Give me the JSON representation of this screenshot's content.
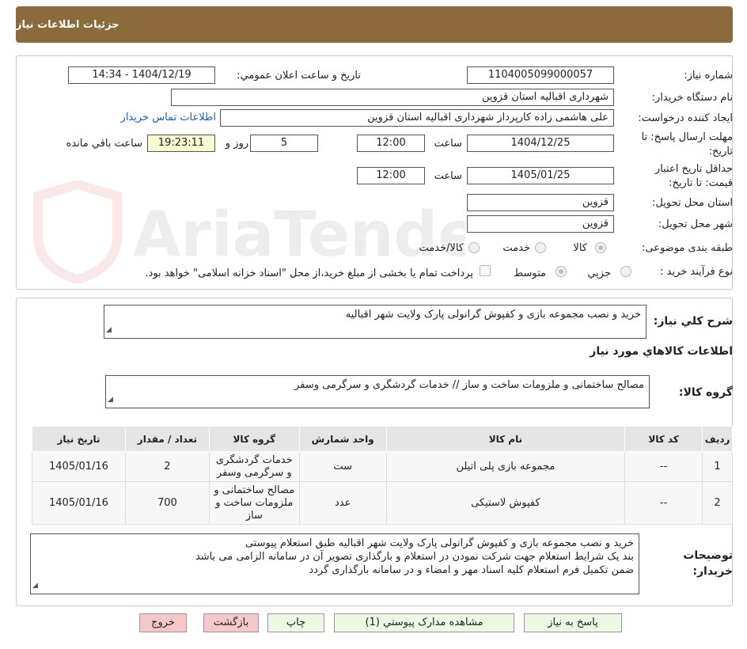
{
  "header": {
    "title": "جزئیات اطلاعات نیاز"
  },
  "watermark": {
    "text": "AriaTender.neT"
  },
  "form": {
    "need_number_label": "شماره نیاز:",
    "need_number": "1104005099000057",
    "announce_label": "تاریخ و ساعت اعلان عمومي:",
    "announce_value": "1404/12/19 - 14:34",
    "buyer_org_label": "نام دستگاه خریدار:",
    "buyer_org": "شهرداری اقبالیه استان قزوین",
    "creator_label": "ایجاد کننده درخواست:",
    "creator": "علی هاشمی زاده کارپرداز شهرداری اقبالیه استان قزوین",
    "contact_link": "اطلاعات تماس خریدار",
    "deadline_label_1": "مهلت ارسال پاسخ: تا",
    "deadline_label_2": "تاریخ:",
    "deadline_date": "1404/12/25",
    "time_label": "ساعت",
    "deadline_time": "12:00",
    "days_value": "5",
    "days_label": "روز و",
    "remaining_time": "19:23:11",
    "remaining_label": "ساعت باقي مانده",
    "validity_label_1": "حداقل تاریخ اعتبار",
    "validity_label_2": "قیمت: تا تاریخ:",
    "validity_date": "1405/01/25",
    "validity_time": "12:00",
    "province_label": "استان محل تحویل:",
    "province": "قزوین",
    "city_label": "شهر محل تحویل:",
    "city": "قزوین",
    "category_label": "طبقه بندی موضوعی:",
    "category_options": [
      "کالا",
      "خدمت",
      "کالا/خدمت"
    ],
    "process_label": "نوع فرآیند خرید :",
    "process_options": [
      "جزیي",
      "متوسط"
    ],
    "payment_note": "پرداخت تمام یا بخشی از مبلغ خرید،از محل \"اسناد خزانه اسلامی\" خواهد بود."
  },
  "summary": {
    "label": "شرح کلي نیاز:",
    "text": "خرید و نصب مجموعه بازی و کفپوش گرانولی پارک ولایت شهر اقبالیه",
    "goods_title": "اطلاعات کالاهاي مورد نیاز",
    "group_label": "گروه کالا:",
    "group_text": "مصالح ساختمانی و ملزومات ساخت و ساز // خدمات گردشگری و سرگرمی وسفر"
  },
  "table": {
    "headers": [
      "ردیف",
      "کد کالا",
      "نام کالا",
      "واحد شمارش",
      "گروه کالا",
      "تعداد / مقدار",
      "تاریخ نیاز"
    ],
    "rows": [
      [
        "1",
        "--",
        "مجموعه بازی پلی اتیلن",
        "ست",
        "خدمات گردشگری و سرگرمی وسفر",
        "2",
        "1405/01/16"
      ],
      [
        "2",
        "--",
        "کفپوش لاستیکی",
        "عدد",
        "مصالح ساختمانی و ملزومات ساخت و ساز",
        "700",
        "1405/01/16"
      ]
    ]
  },
  "buyer_notes": {
    "label_1": "توضیحات",
    "label_2": "خریدار:",
    "lines": [
      "خرید و نصب مجموعه بازی و کفپوش گرانولی پارک ولایت شهر اقبالیه طبق استعلام پیوستی",
      "بند یک شرایط استعلام جهت شرکت نمودن در استعلام و بارگذاری تصویر آن در سامانه الزامی می باشد",
      "ضمن تکمیل فرم استعلام کلیه اسناد مهر و امضاء و در سامانه بارگذاری گردد"
    ]
  },
  "buttons": {
    "reply": "پاسخ به نیاز",
    "attachments": "مشاهده مدارک پیوستي (1)",
    "print": "چاپ",
    "back": "بازگشت",
    "exit": "خروج"
  }
}
